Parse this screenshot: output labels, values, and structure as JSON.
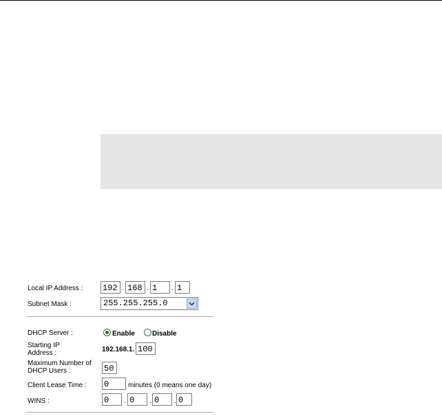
{
  "network": {
    "local_ip_label": "Local IP Address :",
    "local_ip": [
      "192",
      "168",
      "1",
      "1"
    ],
    "subnet_mask_label": "Subnet Mask :",
    "subnet_mask_value": "255.255.255.0"
  },
  "dhcp": {
    "server_label": "DHCP Server :",
    "enable_label": "Enable",
    "disable_label": "Disable",
    "enabled": true,
    "starting_ip_label_line1": "Starting IP",
    "starting_ip_label_line2": "Address :",
    "starting_ip_prefix": "192.168.1.",
    "starting_ip_last": "100",
    "max_users_label_line1": "Maximum Number of",
    "max_users_label_line2": "DHCP Users :",
    "max_users": "50",
    "lease_label": "Client Lease Time :",
    "lease_value": "0",
    "lease_hint": "minutes (0 means one day)",
    "wins_label": "WINS :",
    "wins": [
      "0",
      "0",
      "0",
      "0"
    ]
  },
  "colors": {
    "band": "#e6e6e6",
    "radio_on": "#1e7a1e"
  }
}
